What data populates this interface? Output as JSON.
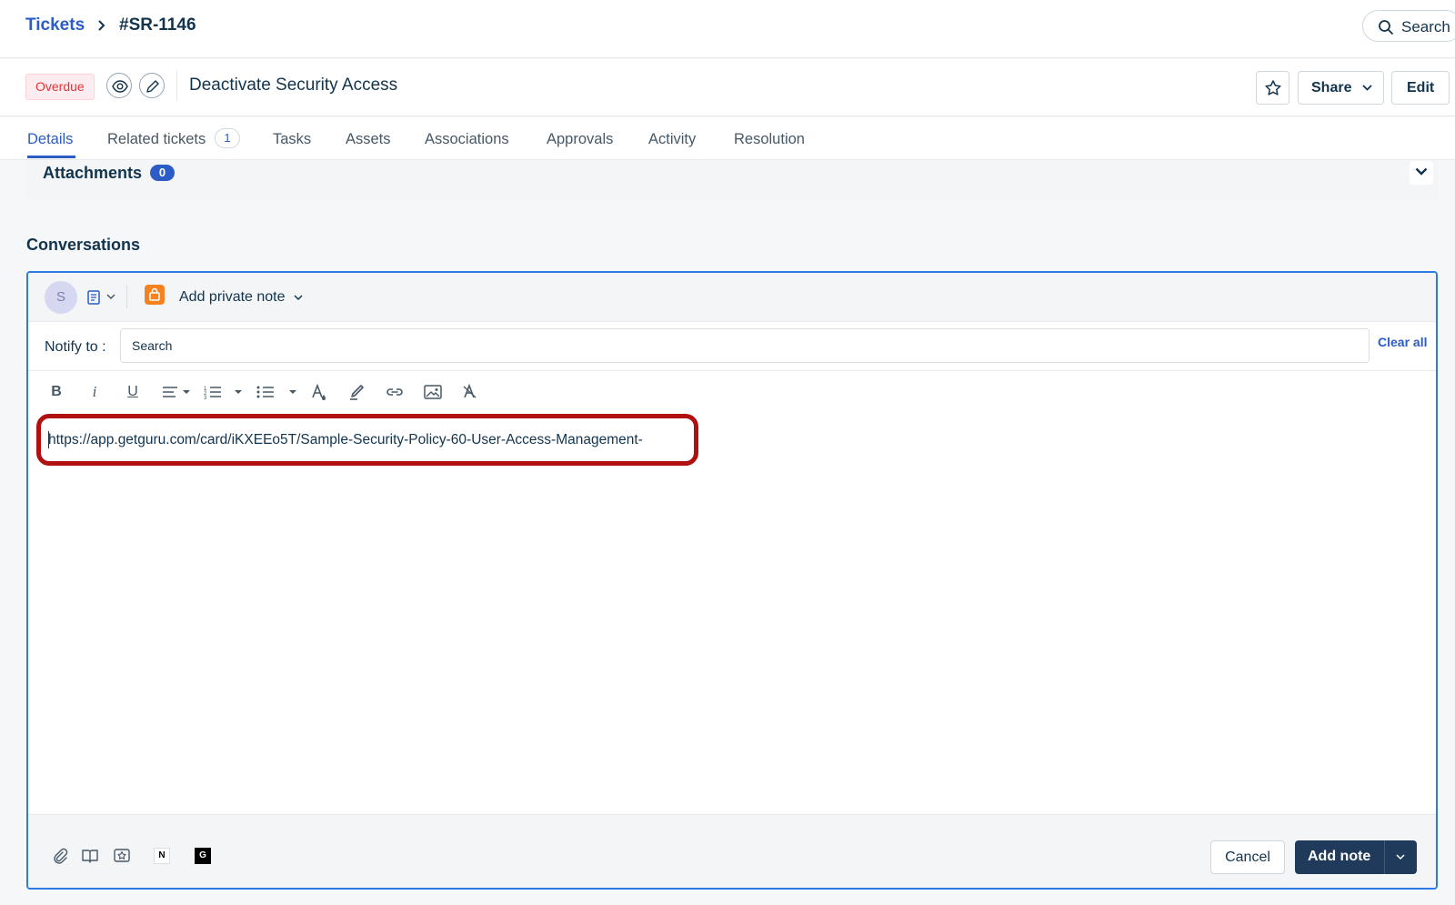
{
  "breadcrumb": {
    "root": "Tickets",
    "current": "#SR-1146"
  },
  "top_search": {
    "label": "Search"
  },
  "ticket": {
    "status_badge": "Overdue",
    "title": "Deactivate Security Access",
    "share_label": "Share",
    "edit_label": "Edit"
  },
  "tabs": [
    {
      "label": "Details",
      "active": true
    },
    {
      "label": "Related tickets",
      "count": "1"
    },
    {
      "label": "Tasks"
    },
    {
      "label": "Assets"
    },
    {
      "label": "Associations"
    },
    {
      "label": "Approvals"
    },
    {
      "label": "Activity"
    },
    {
      "label": "Resolution"
    }
  ],
  "attachments": {
    "label": "Attachments",
    "count": "0"
  },
  "conversations": {
    "title": "Conversations",
    "editor": {
      "avatar_initial": "S",
      "note_type": "Add private note",
      "notify_label": "Notify to :",
      "notify_placeholder": "Search",
      "clear_all": "Clear all",
      "toolbar": {
        "bold": "B",
        "italic": "i",
        "underline": "U"
      },
      "body_text": "https://app.getguru.com/card/iKXEEo5T/Sample-Security-Policy-60-User-Access-Management-",
      "footer": {
        "notion_label": "N",
        "guru_label": "G",
        "cancel_label": "Cancel",
        "add_note_label": "Add note"
      }
    }
  },
  "colors": {
    "brand_blue": "#2c5cc5",
    "focus_blue": "#2c7be5",
    "overdue_red": "#e43538",
    "private_note_orange": "#f58220",
    "primary_button": "#1f3a5a",
    "highlight_red": "#b11010"
  }
}
